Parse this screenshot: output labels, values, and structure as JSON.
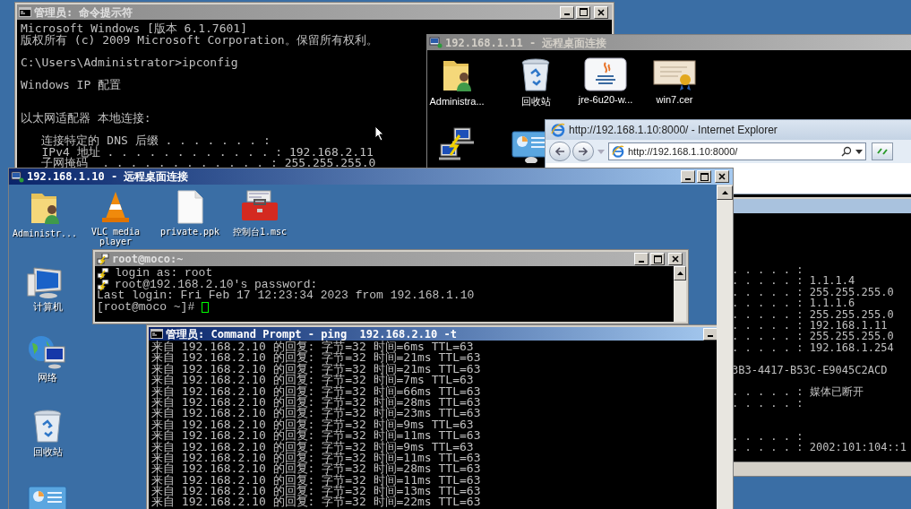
{
  "host_cmd": {
    "title": "管理员: 命令提示符",
    "active": false,
    "lines": [
      {
        "kind": "text",
        "text": "Microsoft Windows [版本 6.1.7601]"
      },
      {
        "kind": "text",
        "text": "版权所有 (c) 2009 Microsoft Corporation。保留所有权利。"
      },
      {
        "kind": "blank"
      },
      {
        "kind": "text",
        "text": "C:\\Users\\Administrator>ipconfig"
      },
      {
        "kind": "blank"
      },
      {
        "kind": "text",
        "text": "Windows IP 配置"
      },
      {
        "kind": "blank"
      },
      {
        "kind": "blank"
      },
      {
        "kind": "text",
        "text": "以太网适配器 本地连接:"
      },
      {
        "kind": "blank"
      },
      {
        "kind": "text",
        "text": "   连接特定的 DNS 后缀 . . . . . . . :"
      },
      {
        "kind": "text",
        "text": "   IPv4 地址 . . . . . . . . . . . . : 192.168.2.11"
      },
      {
        "kind": "text",
        "text": "   子网掩码  . . . . . . . . . . . . : 255.255.255.0"
      }
    ]
  },
  "rdp_11": {
    "title": "192.168.1.11 - 远程桌面连接",
    "active": false,
    "icons": [
      {
        "label": "Administra..."
      },
      {
        "label": "回收站"
      },
      {
        "label": "jre-6u20-w..."
      },
      {
        "label": "win7.cer"
      }
    ],
    "cmd_lines": [
      {
        "kind": "text",
        "text": ". . . . . :"
      },
      {
        "kind": "text",
        "text": ". . . . . : 1.1.1.4"
      },
      {
        "kind": "text",
        "text": ". . . . . : 255.255.255.0"
      },
      {
        "kind": "text",
        "text": ". . . . . : 1.1.1.6"
      },
      {
        "kind": "text",
        "text": ". . . . . : 255.255.255.0"
      },
      {
        "kind": "text",
        "text": ". . . . . : 192.168.1.11"
      },
      {
        "kind": "text",
        "text": ". . . . . : 255.255.255.0"
      },
      {
        "kind": "text",
        "text": ". . . . . : 192.168.1.254"
      },
      {
        "kind": "blank"
      },
      {
        "kind": "text",
        "text": "3B3-4417-B53C-E9045C2ACD"
      },
      {
        "kind": "blank"
      },
      {
        "kind": "text",
        "text": ". . . . . : 媒体已断开"
      },
      {
        "kind": "text",
        "text": ". . . . . :"
      },
      {
        "kind": "blank"
      },
      {
        "kind": "blank"
      },
      {
        "kind": "text",
        "text": ". . . . . :"
      },
      {
        "kind": "text",
        "text": ". . . . . : 2002:101:104::1"
      }
    ]
  },
  "browser": {
    "title": "http://192.168.1.10:8000/ - Internet Explorer",
    "address": "http://192.168.1.10:8000/"
  },
  "rdp_10": {
    "title": "192.168.1.10 - 远程桌面连接",
    "active": true,
    "icons": [
      {
        "label": "Administr..."
      },
      {
        "label": "VLC media player"
      },
      {
        "label": "private.ppk"
      },
      {
        "label": "控制台1.msc"
      },
      {
        "label": "计算机"
      },
      {
        "label": "网络"
      },
      {
        "label": "回收站"
      }
    ]
  },
  "putty": {
    "title": "root@moco:~",
    "active": false,
    "lines": [
      {
        "kind": "prompt",
        "text": "login as: root"
      },
      {
        "kind": "prompt",
        "text": "root@192.168.2.10's password:"
      },
      {
        "kind": "text",
        "text": "Last login: Fri Feb 17 12:23:34 2023 from 192.168.1.10"
      },
      {
        "kind": "cursor",
        "text": "[root@moco ~]#"
      }
    ]
  },
  "ping": {
    "title": "管理员: Command Prompt - ping  192.168.2.10 -t",
    "active": true,
    "lines": [
      "来自 192.168.2.10 的回复: 字节=32 时间=6ms TTL=63",
      "来自 192.168.2.10 的回复: 字节=32 时间=21ms TTL=63",
      "来自 192.168.2.10 的回复: 字节=32 时间=21ms TTL=63",
      "来自 192.168.2.10 的回复: 字节=32 时间=7ms TTL=63",
      "来自 192.168.2.10 的回复: 字节=32 时间=66ms TTL=63",
      "来自 192.168.2.10 的回复: 字节=32 时间=28ms TTL=63",
      "来自 192.168.2.10 的回复: 字节=32 时间=23ms TTL=63",
      "来自 192.168.2.10 的回复: 字节=32 时间=9ms TTL=63",
      "来自 192.168.2.10 的回复: 字节=32 时间=11ms TTL=63",
      "来自 192.168.2.10 的回复: 字节=32 时间=9ms TTL=63",
      "来自 192.168.2.10 的回复: 字节=32 时间=11ms TTL=63",
      "来自 192.168.2.10 的回复: 字节=32 时间=28ms TTL=63",
      "来自 192.168.2.10 的回复: 字节=32 时间=11ms TTL=63",
      "来自 192.168.2.10 的回复: 字节=32 时间=13ms TTL=63",
      "来自 192.168.2.10 的回复: 字节=32 时间=22ms TTL=63"
    ]
  }
}
